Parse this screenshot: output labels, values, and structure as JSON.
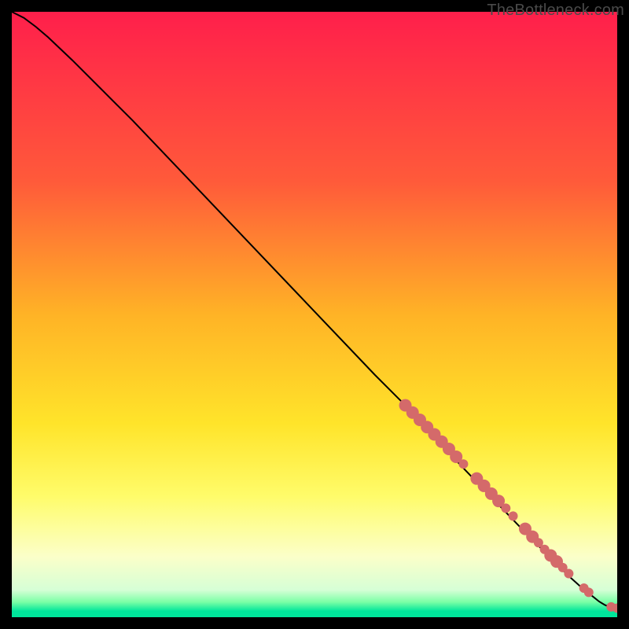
{
  "watermark": "TheBottleneck.com",
  "chart_data": {
    "type": "line",
    "title": "",
    "xlabel": "",
    "ylabel": "",
    "xlim": [
      0,
      100
    ],
    "ylim": [
      0,
      100
    ],
    "grid": false,
    "legend": false,
    "background_gradient_stops": [
      {
        "offset": 0.0,
        "color": "#ff1f4b"
      },
      {
        "offset": 0.28,
        "color": "#ff5a3a"
      },
      {
        "offset": 0.5,
        "color": "#ffb326"
      },
      {
        "offset": 0.68,
        "color": "#ffe42a"
      },
      {
        "offset": 0.8,
        "color": "#fffc6a"
      },
      {
        "offset": 0.9,
        "color": "#fbffc9"
      },
      {
        "offset": 0.955,
        "color": "#d6ffd6"
      },
      {
        "offset": 0.975,
        "color": "#7bffa6"
      },
      {
        "offset": 0.99,
        "color": "#00e69b"
      },
      {
        "offset": 1.0,
        "color": "#00e69b"
      }
    ],
    "series": [
      {
        "name": "curve",
        "color": "#000000",
        "x": [
          0,
          2,
          4,
          6,
          8,
          10,
          15,
          20,
          30,
          40,
          50,
          60,
          65,
          70,
          75,
          80,
          85,
          88,
          90,
          92,
          94,
          95,
          96,
          97,
          98,
          99,
          100
        ],
        "y": [
          100,
          99,
          97.5,
          95.8,
          93.9,
          92,
          87,
          82,
          71.5,
          61,
          50.5,
          40,
          35,
          29.5,
          24.2,
          19,
          13.8,
          10.8,
          8.8,
          6.8,
          5,
          4.2,
          3.4,
          2.6,
          2.0,
          1.6,
          1.4
        ]
      }
    ],
    "scatter_points": {
      "name": "markers",
      "color": "#d46a6a",
      "radius_small": 6,
      "radius_large": 8,
      "points": [
        {
          "x": 65.0,
          "y": 35.0,
          "r": 8
        },
        {
          "x": 66.2,
          "y": 33.8,
          "r": 8
        },
        {
          "x": 67.4,
          "y": 32.6,
          "r": 8
        },
        {
          "x": 68.6,
          "y": 31.4,
          "r": 8
        },
        {
          "x": 69.8,
          "y": 30.2,
          "r": 8
        },
        {
          "x": 71.0,
          "y": 29.0,
          "r": 8
        },
        {
          "x": 72.2,
          "y": 27.8,
          "r": 8
        },
        {
          "x": 73.4,
          "y": 26.5,
          "r": 8
        },
        {
          "x": 74.6,
          "y": 25.3,
          "r": 6
        },
        {
          "x": 76.8,
          "y": 22.9,
          "r": 8
        },
        {
          "x": 78.0,
          "y": 21.7,
          "r": 8
        },
        {
          "x": 79.2,
          "y": 20.4,
          "r": 8
        },
        {
          "x": 80.4,
          "y": 19.2,
          "r": 8
        },
        {
          "x": 81.6,
          "y": 18.0,
          "r": 6
        },
        {
          "x": 82.8,
          "y": 16.7,
          "r": 6
        },
        {
          "x": 84.8,
          "y": 14.6,
          "r": 8
        },
        {
          "x": 86.0,
          "y": 13.3,
          "r": 8
        },
        {
          "x": 87.0,
          "y": 12.3,
          "r": 6
        },
        {
          "x": 88.0,
          "y": 11.2,
          "r": 6
        },
        {
          "x": 89.0,
          "y": 10.2,
          "r": 8
        },
        {
          "x": 90.0,
          "y": 9.2,
          "r": 8
        },
        {
          "x": 91.0,
          "y": 8.2,
          "r": 6
        },
        {
          "x": 92.0,
          "y": 7.2,
          "r": 6
        },
        {
          "x": 94.5,
          "y": 4.8,
          "r": 6
        },
        {
          "x": 95.3,
          "y": 4.1,
          "r": 6
        },
        {
          "x": 99.0,
          "y": 1.7,
          "r": 6
        },
        {
          "x": 100.0,
          "y": 1.5,
          "r": 6
        }
      ]
    }
  }
}
